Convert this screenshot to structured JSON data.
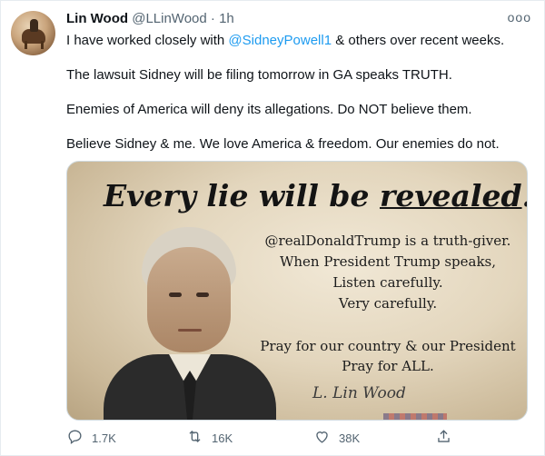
{
  "tweet": {
    "author_name": "Lin Wood",
    "author_handle": "@LLinWood",
    "separator": "·",
    "time": "1h",
    "more_label": "ooo",
    "text": {
      "line1_prefix": "I have worked closely with ",
      "line1_mention": "@SidneyPowell1",
      "line1_suffix": " & others over recent weeks.",
      "line2": "The lawsuit Sidney will be filing tomorrow in GA speaks TRUTH.",
      "line3": "Enemies of America will deny its allegations. Do NOT believe them.",
      "line4": "Believe Sidney & me. We love America & freedom. Our enemies do not."
    },
    "image": {
      "headline_part1": "Every lie will be ",
      "headline_part2": "revealed",
      "headline_part3": ".",
      "quote_lines": [
        "@realDonaldTrump is a truth-giver.",
        "When President Trump speaks,",
        "Listen carefully.",
        "Very carefully."
      ],
      "prayer_lines": [
        "Pray for our country & our President",
        "Pray for ALL."
      ],
      "signature": "L. Lin Wood"
    },
    "actions": {
      "reply_count": "1.7K",
      "retweet_count": "16K",
      "like_count": "38K"
    }
  },
  "colors": {
    "link": "#1d9bf0",
    "muted": "#536471"
  },
  "icons": [
    "reply-icon",
    "retweet-icon",
    "like-icon",
    "share-icon",
    "more-icon"
  ]
}
